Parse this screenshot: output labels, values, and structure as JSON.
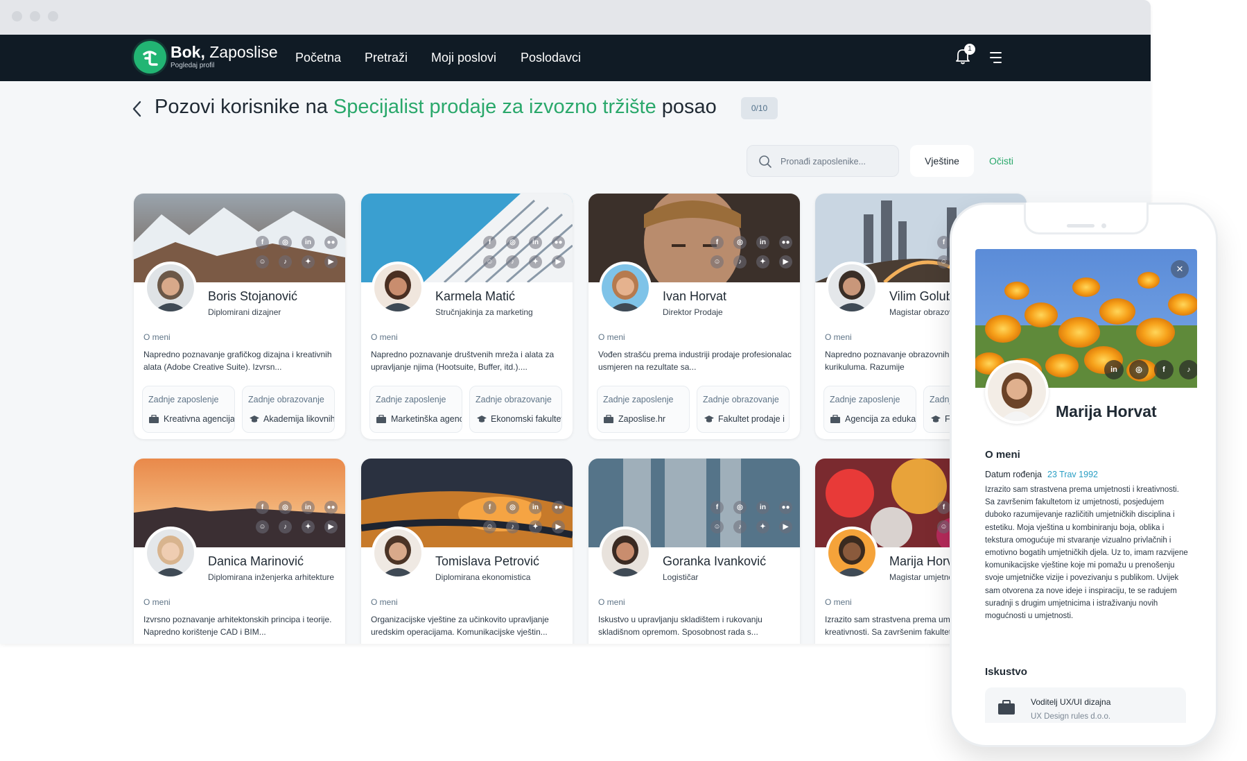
{
  "header": {
    "brand_greeting": "Bok,",
    "brand_name": "Zaposlise",
    "brand_sub": "Pogledaj profil",
    "nav": [
      "Početna",
      "Pretraži",
      "Moji poslovi",
      "Poslodavci"
    ],
    "notification_count": "1"
  },
  "page": {
    "title_prefix": "Pozovi korisnike na",
    "title_job": "Specijalist prodaje za izvozno tržište",
    "title_suffix": "posao",
    "counter": "0/10"
  },
  "filters": {
    "search_placeholder": "Pronađi zaposlenike...",
    "skills_label": "Vještine",
    "clear_label": "Očisti"
  },
  "labels": {
    "about": "O meni",
    "last_job": "Zadnje zaposlenje",
    "last_edu": "Zadnje obrazovanje"
  },
  "social_icons": [
    "facebook-icon",
    "instagram-icon",
    "linkedin-icon",
    "medium-icon",
    "reddit-icon",
    "tiktok-icon",
    "twitter-icon",
    "youtube-icon"
  ],
  "cards": [
    {
      "name": "Boris Stojanović",
      "role": "Diplomirani dizajner",
      "about": "Napredno poznavanje grafičkog dizajna i kreativnih alata (Adobe Creative Suite). Izvrsn...",
      "last_job": "Kreativna agencija",
      "last_edu": "Akademija likovnih"
    },
    {
      "name": "Karmela Matić",
      "role": "Stručnjakinja za marketing",
      "about": "Napredno poznavanje društvenih mreža i alata za upravljanje njima (Hootsuite, Buffer, itd.)....",
      "last_job": "Marketinška agencija",
      "last_edu": "Ekonomski fakultet"
    },
    {
      "name": "Ivan Horvat",
      "role": "Direktor Prodaje",
      "about": "Vođen strašću prema industriji prodaje profesionalac usmjeren na rezultate sa...",
      "last_job": "Zaposlise.hr",
      "last_edu": "Fakultet prodaje i"
    },
    {
      "name": "Vilim Golub",
      "role": "Magistar obrazovanja",
      "about": "Napredno poznavanje obrazovnih pedagogije i kurikuluma. Razumije",
      "last_job": "Agencija za edukaciju",
      "last_edu": "Filozofski"
    },
    {
      "name": "Danica Marinović",
      "role": "Diplomirana inženjerka arhitekture",
      "about": "Izvrsno poznavanje arhitektonskih principa i teorije. Napredno korištenje CAD i BIM..."
    },
    {
      "name": "Tomislava Petrović",
      "role": "Diplomirana ekonomistica",
      "about": "Organizacijske vještine za učinkovito upravljanje uredskim operacijama. Komunikacijske vještin..."
    },
    {
      "name": "Goranka Ivanković",
      "role": "Logističar",
      "about": "Iskustvo u upravljanju skladištem i rukovanju skladišnom opremom. Sposobnost rada s..."
    },
    {
      "name": "Marija Horvat",
      "role": "Magistar umjetnosti",
      "about": "Izrazito sam strastvena prema umjetnosti i kreativnosti. Sa završenim fakultetom"
    }
  ],
  "profile": {
    "name": "Marija Horvat",
    "about_title": "O meni",
    "dob_label": "Datum rođenja",
    "dob_value": "23 Trav 1992",
    "bio": "Izrazito sam strastvena prema umjetnosti i kreativnosti. Sa završenim fakultetom iz umjetnosti, posjedujem duboko razumijevanje različitih umjetničkih disciplina i estetiku. Moja vještina u kombiniranju boja, oblika i tekstura omogućuje mi stvaranje vizualno privlačnih i emotivno bogatih umjetničkih djela. Uz to, imam razvijene komunikacijske vještine koje mi pomažu u prenošenju svoje umjetničke vizije i povezivanju s publikom. Uvijek sam otvorena za nove ideje i inspiraciju, te se radujem suradnji s drugim umjetnicima i istraživanju novih mogućnosti u umjetnosti.",
    "experience_title": "Iskustvo",
    "experience": {
      "title": "Voditelj UX/UI dizajna",
      "company": "UX Design rules d.o.o."
    },
    "social_icons": [
      "linkedin-icon",
      "instagram-icon",
      "facebook-icon",
      "tiktok-icon"
    ]
  },
  "colors": {
    "accent": "#2aa86b",
    "nav_bg": "#101b25",
    "page_bg": "#f5f7f9"
  }
}
